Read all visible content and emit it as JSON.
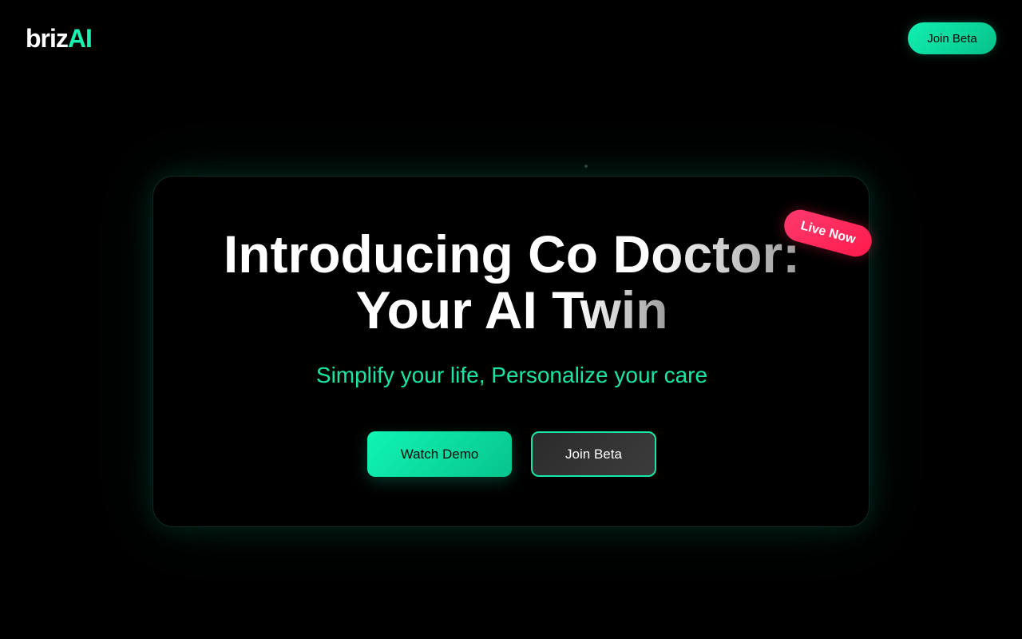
{
  "header": {
    "logo_part1": "briz",
    "logo_part2": "AI",
    "cta_label": "Join Beta"
  },
  "hero": {
    "title_line1_start": "Introducing Co ",
    "title_line1_gradient": "Doctor:",
    "title_line2_start": "Your AI ",
    "title_line2_gradient": "Twin",
    "subtitle": "Simplify your life, Personalize your care",
    "primary_button_label": "Watch Demo",
    "secondary_button_label": "Join Beta",
    "badge_label": "Live Now"
  },
  "colors": {
    "background": "#000000",
    "accent": "#19e6a6",
    "badge": "#ff1a4b"
  }
}
